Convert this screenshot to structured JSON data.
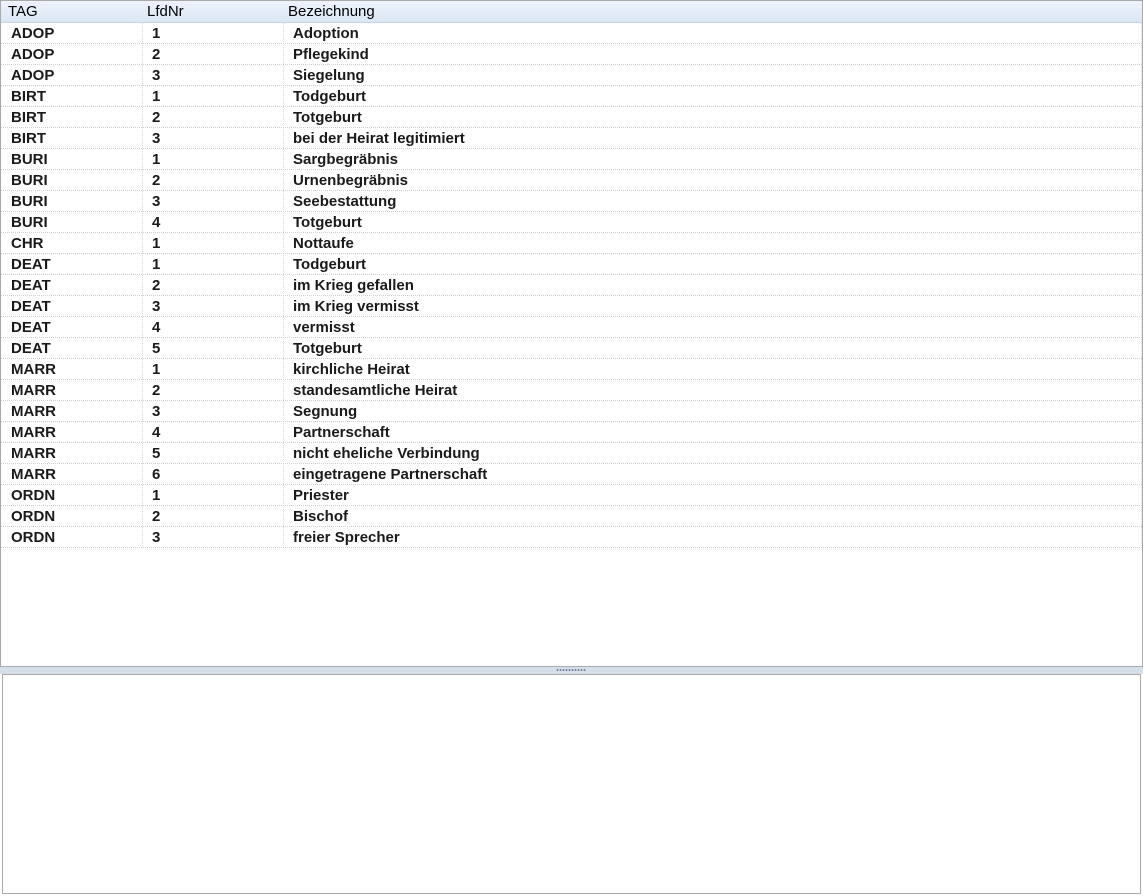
{
  "grid": {
    "columns": [
      "TAG",
      "LfdNr",
      "Bezeichnung"
    ],
    "rows": [
      [
        "ADOP",
        "1",
        "Adoption"
      ],
      [
        "ADOP",
        "2",
        "Pflegekind"
      ],
      [
        "ADOP",
        "3",
        "Siegelung"
      ],
      [
        "BIRT",
        "1",
        "Todgeburt"
      ],
      [
        "BIRT",
        "2",
        "Totgeburt"
      ],
      [
        "BIRT",
        "3",
        "bei der Heirat legitimiert"
      ],
      [
        "BURI",
        "1",
        "Sargbegräbnis"
      ],
      [
        "BURI",
        "2",
        "Urnenbegräbnis"
      ],
      [
        "BURI",
        "3",
        "Seebestattung"
      ],
      [
        "BURI",
        "4",
        "Totgeburt"
      ],
      [
        "CHR",
        "1",
        "Nottaufe"
      ],
      [
        "DEAT",
        "1",
        "Todgeburt"
      ],
      [
        "DEAT",
        "2",
        "im Krieg gefallen"
      ],
      [
        "DEAT",
        "3",
        "im Krieg vermisst"
      ],
      [
        "DEAT",
        "4",
        "vermisst"
      ],
      [
        "DEAT",
        "5",
        "Totgeburt"
      ],
      [
        "MARR",
        "1",
        "kirchliche Heirat"
      ],
      [
        "MARR",
        "2",
        "standesamtliche Heirat"
      ],
      [
        "MARR",
        "3",
        "Segnung"
      ],
      [
        "MARR",
        "4",
        "Partnerschaft"
      ],
      [
        "MARR",
        "5",
        "nicht eheliche Verbindung"
      ],
      [
        "MARR",
        "6",
        "eingetragene Partnerschaft"
      ],
      [
        "ORDN",
        "1",
        "Priester"
      ],
      [
        "ORDN",
        "2",
        "Bischof"
      ],
      [
        "ORDN",
        "3",
        "freier Sprecher"
      ]
    ]
  },
  "colors": {
    "header_bg": "#dbe6f5",
    "grid_line": "#cfcfcf",
    "splitter_bg": "#d6deea"
  }
}
